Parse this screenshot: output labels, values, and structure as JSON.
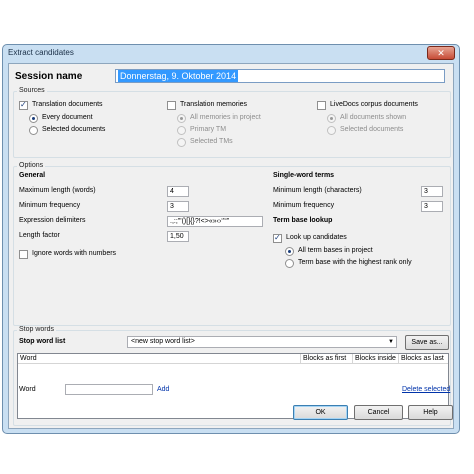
{
  "window": {
    "title": "Extract candidates",
    "close": "✕"
  },
  "session": {
    "label": "Session name",
    "value": "Donnerstag, 9. Oktober 2014"
  },
  "sources": {
    "group_label": "Sources",
    "translation_documents": {
      "label": "Translation documents",
      "options": [
        "Every document",
        "Selected documents"
      ]
    },
    "translation_memories": {
      "label": "Translation memories",
      "options": [
        "All memories in project",
        "Primary TM",
        "Selected TMs"
      ]
    },
    "livedocs": {
      "label": "LiveDocs corpus documents",
      "options": [
        "All documents shown",
        "Selected documents"
      ]
    }
  },
  "options": {
    "group_label": "Options",
    "general": {
      "heading": "General",
      "max_length_label": "Maximum length (words)",
      "max_length_value": "4",
      "min_frequency_label": "Minimum frequency",
      "min_frequency_value": "3",
      "expression_delimiters_label": "Expression delimiters",
      "expression_delimiters_value": ".,:;\"'()[]{}?!<>«»‹›‘’“”",
      "length_factor_label": "Length factor",
      "length_factor_value": "1,50",
      "ignore_numbers_label": "Ignore words with numbers"
    },
    "single_word": {
      "heading": "Single-word terms",
      "min_length_label": "Minimum length (characters)",
      "min_length_value": "3",
      "min_frequency_label": "Minimum frequency",
      "min_frequency_value": "3"
    },
    "term_base": {
      "heading": "Term base lookup",
      "lookup_label": "Look up candidates",
      "options": [
        "All term bases in project",
        "Term base with the highest rank only"
      ]
    }
  },
  "stop_words": {
    "group_label": "Stop words",
    "list_label": "Stop word list",
    "list_value": "<new stop word list>",
    "save_as": "Save as...",
    "columns": [
      "Word",
      "Blocks as first",
      "Blocks inside",
      "Blocks as last"
    ],
    "word_label": "Word",
    "word_value": "",
    "add": "Add",
    "delete": "Delete selected"
  },
  "buttons": {
    "ok": "OK",
    "cancel": "Cancel",
    "help": "Help"
  }
}
